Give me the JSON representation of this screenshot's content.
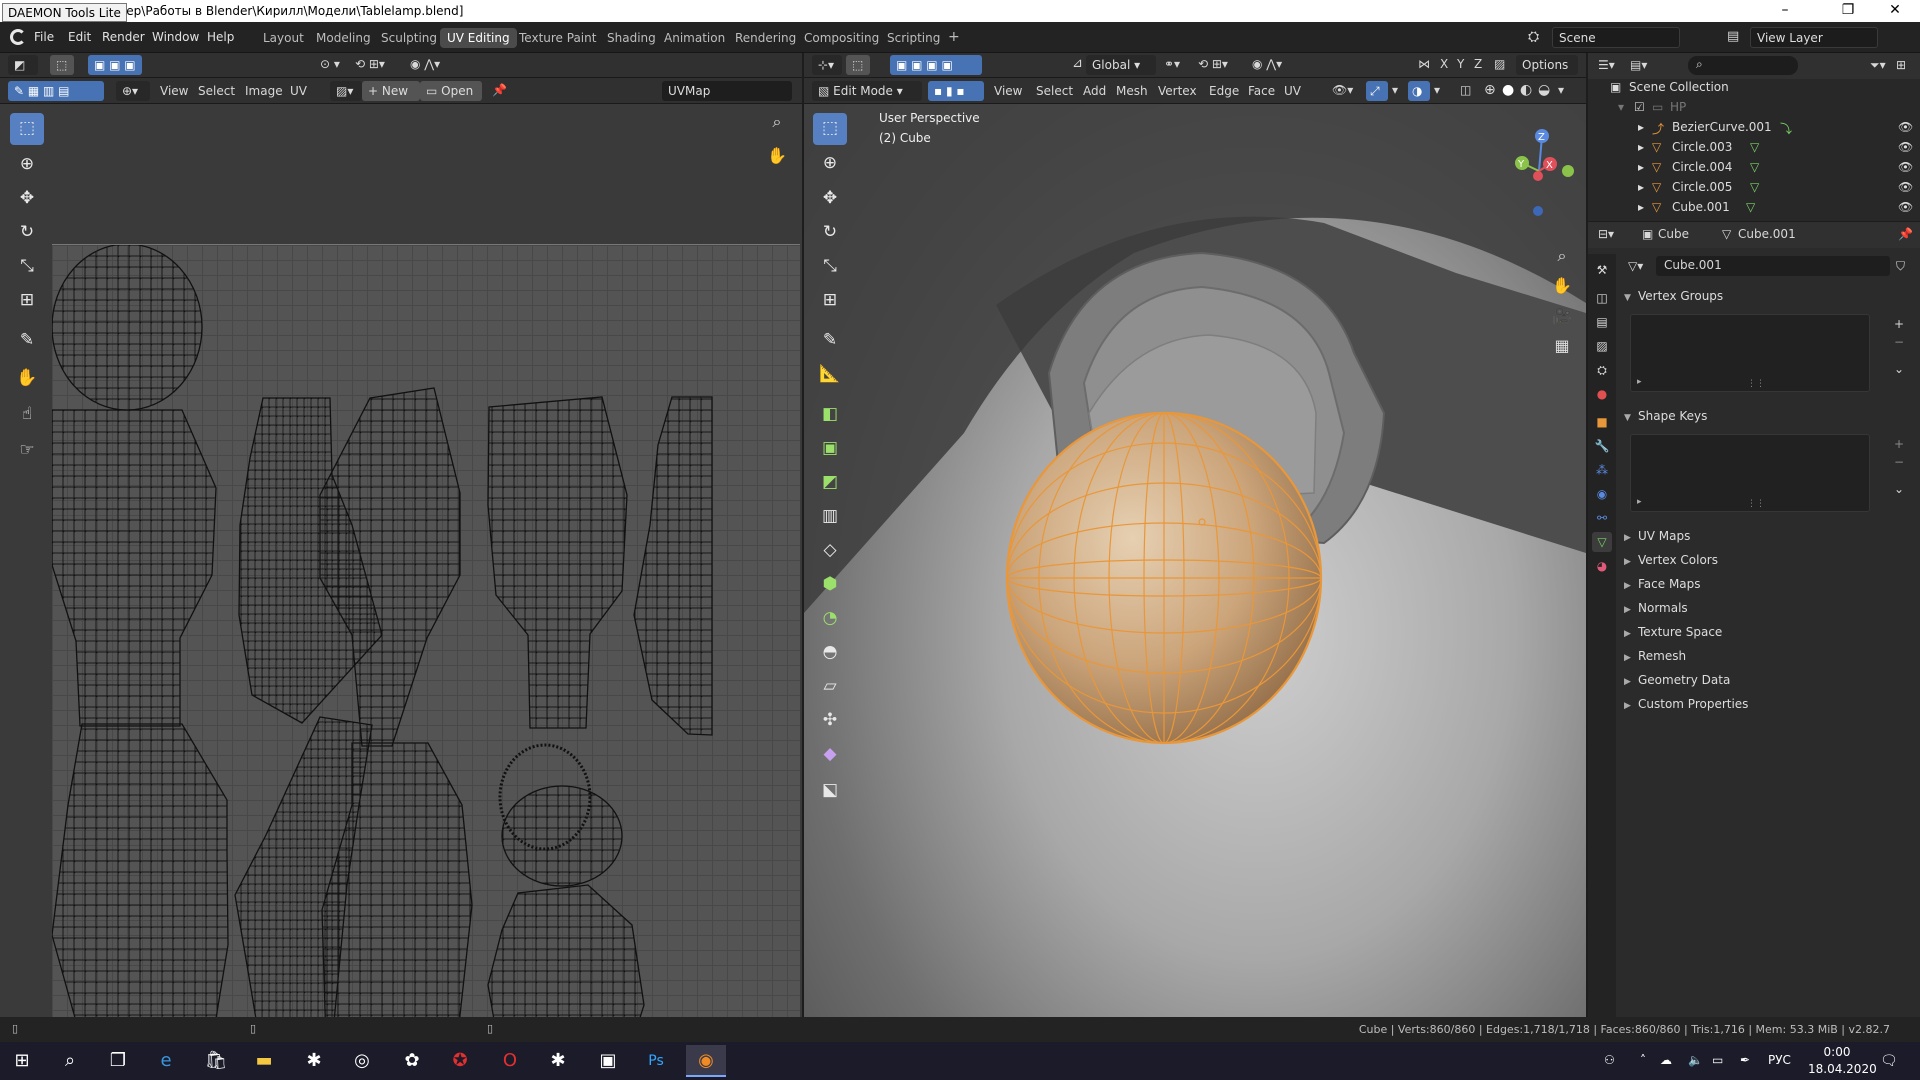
{
  "window": {
    "tooltip": "DAEMON Tools Lite",
    "title": "дер\\Работы в Blender\\Кирилл\\Модели\\Tablelamp.blend]",
    "minimize": "–",
    "restore": "❐",
    "close": "✕"
  },
  "menu": [
    "File",
    "Edit",
    "Render",
    "Window",
    "Help"
  ],
  "workspaces": [
    "Layout",
    "Modeling",
    "Sculpting",
    "UV Editing",
    "Texture Paint",
    "Shading",
    "Animation",
    "Rendering",
    "Compositing",
    "Scripting"
  ],
  "workspace_active": "UV Editing",
  "add_workspace": "+",
  "scene": {
    "label": "Scene",
    "view_layer": "View Layer"
  },
  "uv_editor": {
    "menus": [
      "View",
      "Select",
      "Image",
      "UV"
    ],
    "new_label": "New",
    "open_label": "Open",
    "uvmap": "UVMap"
  },
  "viewport": {
    "mode": "Edit Mode",
    "menus": [
      "View",
      "Select",
      "Add",
      "Mesh",
      "Vertex",
      "Edge",
      "Face",
      "UV"
    ],
    "orientation": "Global",
    "options": "Options",
    "axes": [
      "X",
      "Y",
      "Z"
    ],
    "overlay_line1": "User Perspective",
    "overlay_line2": "(2) Cube",
    "gizmo": {
      "z": "Z",
      "y": "Y",
      "x": "X"
    }
  },
  "outliner": {
    "collection": "Scene Collection",
    "items": [
      {
        "name": "HP",
        "dim": true
      },
      {
        "name": "BezierCurve.001"
      },
      {
        "name": "Circle.003"
      },
      {
        "name": "Circle.004"
      },
      {
        "name": "Circle.005"
      },
      {
        "name": "Cube.001"
      }
    ]
  },
  "properties": {
    "object": "Cube",
    "mesh": "Cube.001",
    "datablock": "Cube.001",
    "sections": [
      "Vertex Groups",
      "Shape Keys",
      "UV Maps",
      "Vertex Colors",
      "Face Maps",
      "Normals",
      "Texture Space",
      "Remesh",
      "Geometry Data",
      "Custom Properties"
    ]
  },
  "status": "Cube | Verts:860/860 | Edges:1,718/1,718 | Faces:860/860 | Tris:1,716 | Mem: 53.3 MiB | v2.82.7",
  "taskbar": {
    "lang": "РУС",
    "time": "0:00",
    "date": "18.04.2020"
  },
  "colors": {
    "accent": "#4772b3",
    "selection": "#f0a030",
    "object_orange": "#e8973a",
    "mesh_green": "#7ad066"
  }
}
